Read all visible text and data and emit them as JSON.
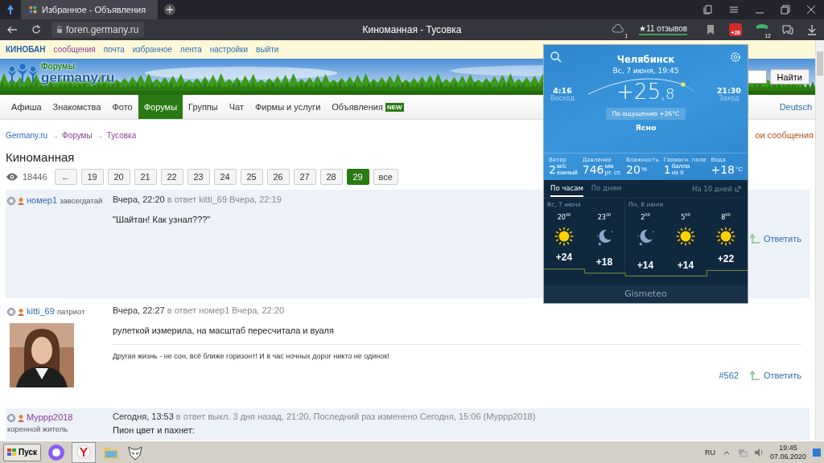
{
  "browser": {
    "tabs": [
      {
        "title": "Избранное - Объявления",
        "selected": true
      }
    ],
    "url": "foren.germany.ru",
    "page_title": "Киноманная - Тусовка",
    "reviews": "★11 отзывов",
    "weather_badge": "+26",
    "shield_count": "12",
    "cloud_count": "1"
  },
  "site": {
    "brand": "КИНОБАН",
    "top_links": [
      {
        "label": "сообщения",
        "visited": true
      },
      {
        "label": "почта",
        "visited": false
      },
      {
        "label": "избранное",
        "visited": false
      },
      {
        "label": "лента",
        "visited": false
      },
      {
        "label": "настройки",
        "visited": false
      },
      {
        "label": "выйти",
        "visited": false
      }
    ],
    "logo": {
      "small": "Форумы",
      "main": "germany.ru"
    },
    "search_button": "Найти",
    "nav": [
      {
        "label": "Афиша",
        "selected": false
      },
      {
        "label": "Знакомства",
        "selected": false
      },
      {
        "label": "Фото",
        "selected": false
      },
      {
        "label": "Форумы",
        "selected": true
      },
      {
        "label": "Группы",
        "selected": false
      },
      {
        "label": "Чат",
        "selected": false
      },
      {
        "label": "Фирмы и услуги",
        "selected": false
      },
      {
        "label": "Объявления",
        "selected": false,
        "badge": "NEW"
      }
    ],
    "language": "Deutsch"
  },
  "breadcrumbs": {
    "separator": "→",
    "items": [
      {
        "label": "Germany.ru",
        "visited": false
      },
      {
        "label": "Форумы",
        "visited": true
      },
      {
        "label": "Тусовка",
        "visited": true
      }
    ]
  },
  "my_messages": "ои сообщения",
  "thread_title": "Киноманная",
  "views": "18446",
  "pages": [
    {
      "label": "←",
      "selected": false
    },
    {
      "label": "19",
      "selected": false
    },
    {
      "label": "20",
      "selected": false
    },
    {
      "label": "21",
      "selected": false
    },
    {
      "label": "22",
      "selected": false
    },
    {
      "label": "23",
      "selected": false
    },
    {
      "label": "24",
      "selected": false
    },
    {
      "label": "25",
      "selected": false
    },
    {
      "label": "26",
      "selected": false
    },
    {
      "label": "27",
      "selected": false
    },
    {
      "label": "28",
      "selected": false
    },
    {
      "label": "29",
      "selected": true
    },
    {
      "label": "все",
      "selected": false
    }
  ],
  "posts": [
    {
      "author": "номер1",
      "visited": false,
      "rank": "завсегдатай",
      "time": "Вчера, 22:20",
      "meta": "в ответ kitti_69 Вчера, 22:19",
      "text": "\"Шайтан! Как узнал???\"",
      "reply": "Ответить",
      "highlighted": true
    },
    {
      "author": "kitti_69",
      "visited": false,
      "rank": "патриот",
      "time": "Вчера, 22:27",
      "meta": "в ответ номер1 Вчера, 22:20",
      "text": "рулеткой измерила, на масштаб пересчитала и вуаля",
      "signature": "Другая жизнь - не сон, всё ближе горизонт! И в час ночных дорог никто не одинок!",
      "number": "#562",
      "reply": "Ответить",
      "highlighted": false
    },
    {
      "author": "Муррр2018",
      "visited": true,
      "rank": "коренной житель",
      "time": "Сегодня, 13:53",
      "meta": "в ответ выкл. 3 дня назад, 21:20, Последний раз изменено Сегодня, 15:06 (Муррр2018)",
      "text": "Пион цвет и пахнет:",
      "highlighted": true
    }
  ],
  "weather": {
    "city": "Челябинск",
    "datetime": "Вс, 7 июня, 19:45",
    "sunrise": {
      "time": "4:16",
      "label": "Восход"
    },
    "sunset": {
      "time": "21:30",
      "label": "Заход"
    },
    "temp_whole": "+25",
    "temp_fraction": ",8",
    "feels": "По ощущению +26°C",
    "condition": "Ясно",
    "stats": [
      {
        "label": "Ветер",
        "value": "2",
        "unit": "м/с",
        "sub": "южный"
      },
      {
        "label": "Давление",
        "value": "746",
        "unit": "мм",
        "sub": "рт. ст."
      },
      {
        "label": "Влажность",
        "value": "20",
        "unit": "%"
      },
      {
        "label": "Геомагн. поле",
        "value": "1",
        "unit": "балла",
        "sub": "из 9"
      },
      {
        "label": "Вода",
        "value": "+18",
        "unit": "°C"
      }
    ],
    "tabs": [
      {
        "label": "По часам",
        "selected": true
      },
      {
        "label": "По дням",
        "selected": false
      }
    ],
    "ten_days": "На 10 дней",
    "days": [
      {
        "label": "Вс, 7 июня",
        "hours": [
          {
            "hour": "20",
            "minutes": "00",
            "kind": "sun",
            "temp": "+24"
          },
          {
            "hour": "23",
            "minutes": "00",
            "kind": "moon",
            "temp": "+18"
          }
        ]
      },
      {
        "label": "Пн, 8 июня",
        "hours": [
          {
            "hour": "2",
            "minutes": "00",
            "kind": "moon",
            "temp": "+14"
          },
          {
            "hour": "5",
            "minutes": "00",
            "kind": "sun",
            "temp": "+14"
          },
          {
            "hour": "8",
            "minutes": "00",
            "kind": "sun",
            "temp": "+22"
          }
        ]
      }
    ],
    "footer": "Gismeteo"
  },
  "taskbar": {
    "start": "Пуск",
    "language": "RU",
    "time": "19:45",
    "date": "07.06.2020"
  }
}
